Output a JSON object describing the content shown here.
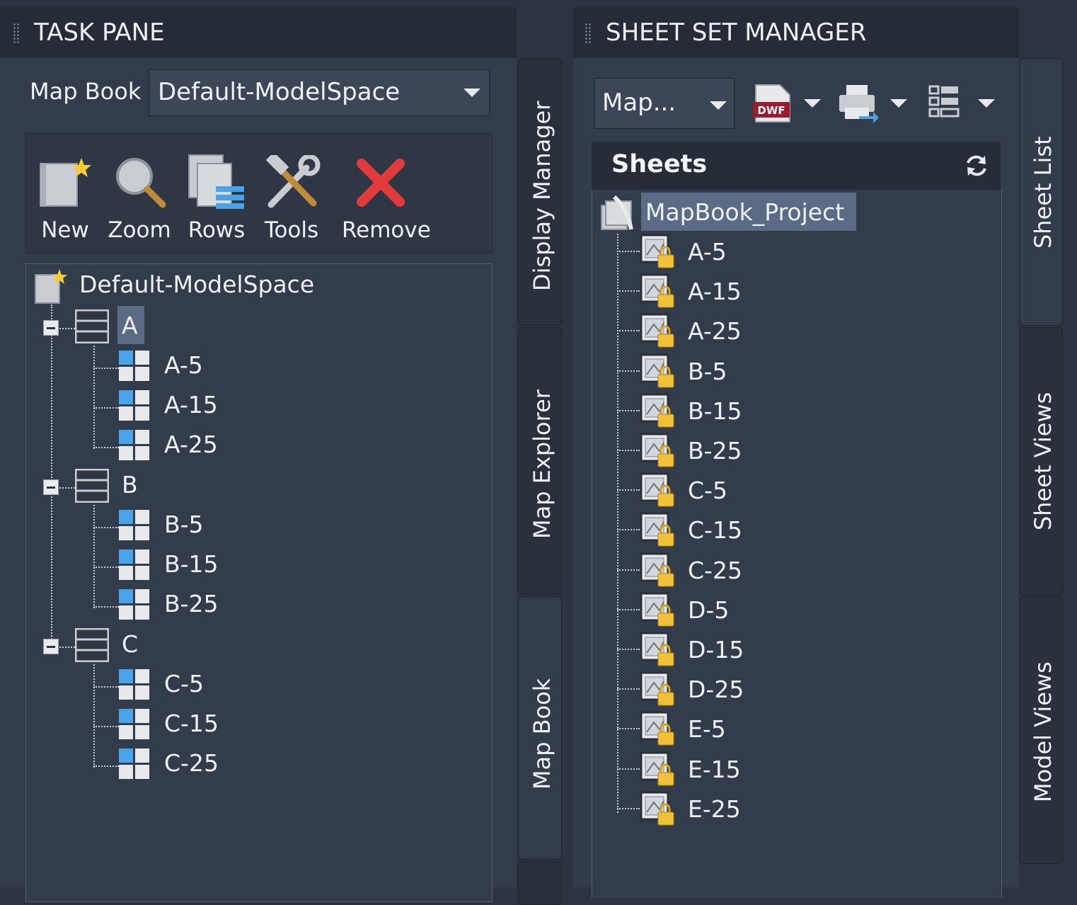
{
  "task_pane": {
    "title": "TASK PANE",
    "map_book_label": "Map Book",
    "map_book_value": "Default-ModelSpace",
    "toolbar": {
      "new": "New",
      "zoom": "Zoom",
      "rows": "Rows",
      "tools": "Tools",
      "remove": "Remove"
    },
    "tree": {
      "root": "Default-ModelSpace",
      "groups": [
        {
          "label": "A",
          "selected": true,
          "items": [
            "A-5",
            "A-15",
            "A-25"
          ]
        },
        {
          "label": "B",
          "selected": false,
          "items": [
            "B-5",
            "B-15",
            "B-25"
          ]
        },
        {
          "label": "C",
          "selected": false,
          "items": [
            "C-5",
            "C-15",
            "C-25"
          ]
        }
      ]
    },
    "side_tabs": [
      "Display Manager",
      "Map Explorer",
      "Map Book"
    ]
  },
  "sheet_set_manager": {
    "title": "SHEET SET MANAGER",
    "combo_value": "Map...",
    "sheets_header": "Sheets",
    "project": "MapBook_Project",
    "sheets": [
      "A-5",
      "A-15",
      "A-25",
      "B-5",
      "B-15",
      "B-25",
      "C-5",
      "C-15",
      "C-25",
      "D-5",
      "D-15",
      "D-25",
      "E-5",
      "E-15",
      "E-25"
    ],
    "side_tabs": [
      "Sheet List",
      "Sheet Views",
      "Model Views"
    ],
    "dwf_label": "DWF"
  },
  "colors": {
    "background": "#2c3441",
    "panel": "#333c4a",
    "title_bar": "#252c37",
    "selection": "#5b6b85",
    "remove_red": "#e23b3b"
  }
}
